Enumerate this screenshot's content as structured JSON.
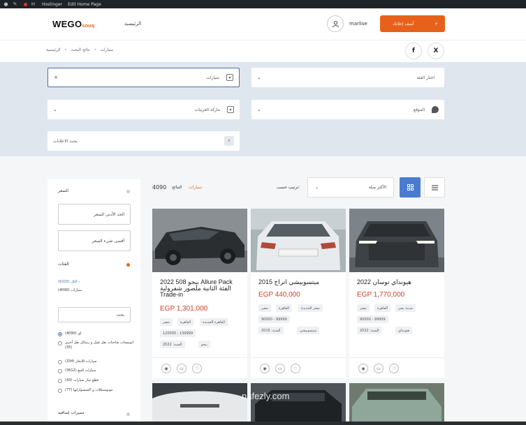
{
  "wp_admin_bar": {
    "site_name": "Hostinger",
    "edit_link": "Edit Home Page"
  },
  "header": {
    "logo_main": "WEGO",
    "logo_sub": "souq",
    "nav_home": "الرئيسية",
    "username": "marlise",
    "add_button": "أضف إعلانك",
    "add_icon": "+"
  },
  "breadcrumb": {
    "items": [
      "الرئيسية",
      "نتائج البحث",
      "سيارات"
    ],
    "separator": "‹",
    "social": [
      "f",
      "X"
    ]
  },
  "search": {
    "category": "سيارات",
    "category_clear": "×",
    "select_category": "اختار الفئة",
    "vehicle_brand": "ماركة العربيات",
    "location": "الموقع",
    "search_ads": "بحث الاعلانات"
  },
  "sidebar": {
    "price_title": "السعر",
    "min_price": "الحد الأدنى السعر",
    "max_price": "أقصى شيء السعر",
    "categories_title": "الفئات",
    "all_label": "الكل (6315) ›",
    "cars_label": "سيارات (4090)",
    "search_btn": "بحث",
    "radio_items": [
      "(4090) اي",
      "اتوبيسات شاحنات نقل ثقيل و رسائل نقل أخرى (35)",
      "سيارات للايجار (334)",
      "سيارات للبيع (3612)",
      "قطع غيار سيارات (43)",
      "موتوسيكلات و اكسسواراتها (77)"
    ],
    "extra_title": "مميزات إضافية"
  },
  "toolbar": {
    "count": "4090",
    "results_label": "النتائج",
    "category": "سيارات",
    "sort_label": "ترتيب حسب:",
    "sort_value": "الأكثر صلة"
  },
  "listings": [
    {
      "title": "2022 بيجو 508 Allure Pack الفئة الثانية ملصور شفرولية Trade-in",
      "price": "EGP 1,301,000",
      "tags": [
        [
          "مصر",
          "القاهرة",
          "القاهرة الجديدة"
        ],
        [
          "120000 - 139999"
        ],
        [
          "بيجو",
          "السنة: 2022"
        ]
      ]
    },
    {
      "title": "ميتسوبيشي اتراج 2015",
      "price": "EGP 440,000",
      "tags": [
        [
          "مصر",
          "القاهرة",
          "مصر الجديدة"
        ],
        [
          "90000 - 99999"
        ],
        [
          "ميتسوبيشي",
          "السنة: 2015"
        ]
      ]
    },
    {
      "title": "هيونداي توسان 2022",
      "price": "EGP 1,770,000",
      "tags": [
        [
          "مصر",
          "القاهرة",
          "مدينة نصر"
        ],
        [
          "90000 - 99999"
        ],
        [
          "هيونداي",
          "السنة: 2022"
        ]
      ]
    }
  ],
  "watermark": "nafezly.com"
}
